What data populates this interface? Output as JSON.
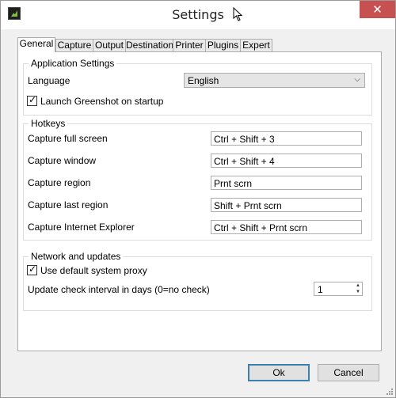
{
  "window": {
    "title": "Settings"
  },
  "tabs": [
    {
      "label": "General",
      "active": true
    },
    {
      "label": "Capture"
    },
    {
      "label": "Output"
    },
    {
      "label": "Destination"
    },
    {
      "label": "Printer"
    },
    {
      "label": "Plugins"
    },
    {
      "label": "Expert"
    }
  ],
  "application_settings": {
    "title": "Application Settings",
    "language_label": "Language",
    "language_value": "English",
    "launch_on_startup_label": "Launch Greenshot on startup",
    "launch_on_startup_checked": true
  },
  "hotkeys": {
    "title": "Hotkeys",
    "rows": [
      {
        "label": "Capture full screen",
        "value": "Ctrl + Shift + 3"
      },
      {
        "label": "Capture window",
        "value": "Ctrl + Shift + 4"
      },
      {
        "label": "Capture region",
        "value": "Prnt scrn"
      },
      {
        "label": "Capture last region",
        "value": "Shift + Prnt scrn"
      },
      {
        "label": "Capture Internet Explorer",
        "value": "Ctrl + Shift + Prnt scrn"
      }
    ]
  },
  "network": {
    "title": "Network and updates",
    "proxy_label": "Use default system proxy",
    "proxy_checked": true,
    "interval_label": "Update check interval in days (0=no check)",
    "interval_value": "1"
  },
  "buttons": {
    "ok": "Ok",
    "cancel": "Cancel"
  },
  "icons": [
    "greenshot-app-icon",
    "mouse-cursor-icon",
    "close-icon",
    "chevron-down-icon",
    "checkmark-icon",
    "spin-up-icon",
    "spin-down-icon",
    "resize-grip-icon"
  ],
  "colors": {
    "close_button": "#c75050",
    "focus_border": "#3c7fb1"
  }
}
